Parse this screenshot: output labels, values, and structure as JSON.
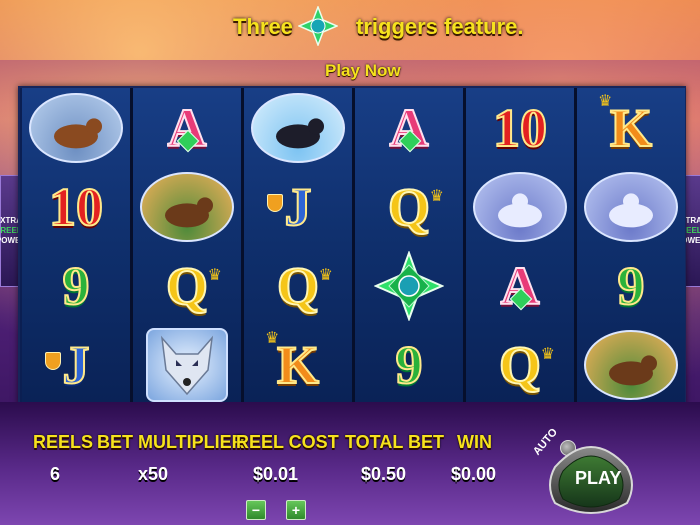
{
  "banner": {
    "message_left": "Three",
    "message_right": "triggers feature.",
    "play_now": "Play Now"
  },
  "side_logo": {
    "line1": "XTRA",
    "line2": "REEL",
    "line3": "POWER"
  },
  "reels": [
    [
      "bear",
      "10",
      "9",
      "J"
    ],
    [
      "A",
      "moose",
      "Q",
      "wolf"
    ],
    [
      "puffins",
      "J",
      "Q",
      "K"
    ],
    [
      "A",
      "Q",
      "gem",
      "9"
    ],
    [
      "10",
      "wolves",
      "A",
      "Q"
    ],
    [
      "K",
      "wolves",
      "9",
      "moose"
    ]
  ],
  "stats": {
    "reels_label": "REELS",
    "reels_value": "6",
    "bet_multiplier_label": "BET MULTIPLIER",
    "bet_multiplier_value": "x50",
    "reel_cost_label": "REEL COST",
    "reel_cost_value": "$0.01",
    "total_bet_label": "TOTAL BET",
    "total_bet_value": "$0.50",
    "win_label": "WIN",
    "win_value": "$0.00"
  },
  "controls": {
    "minus": "−",
    "plus": "+",
    "auto_label": "AUTO",
    "play_label": "PLAY"
  },
  "colors": {
    "accent_yellow": "#f6e21d",
    "play_green": "#2f8a2c"
  }
}
